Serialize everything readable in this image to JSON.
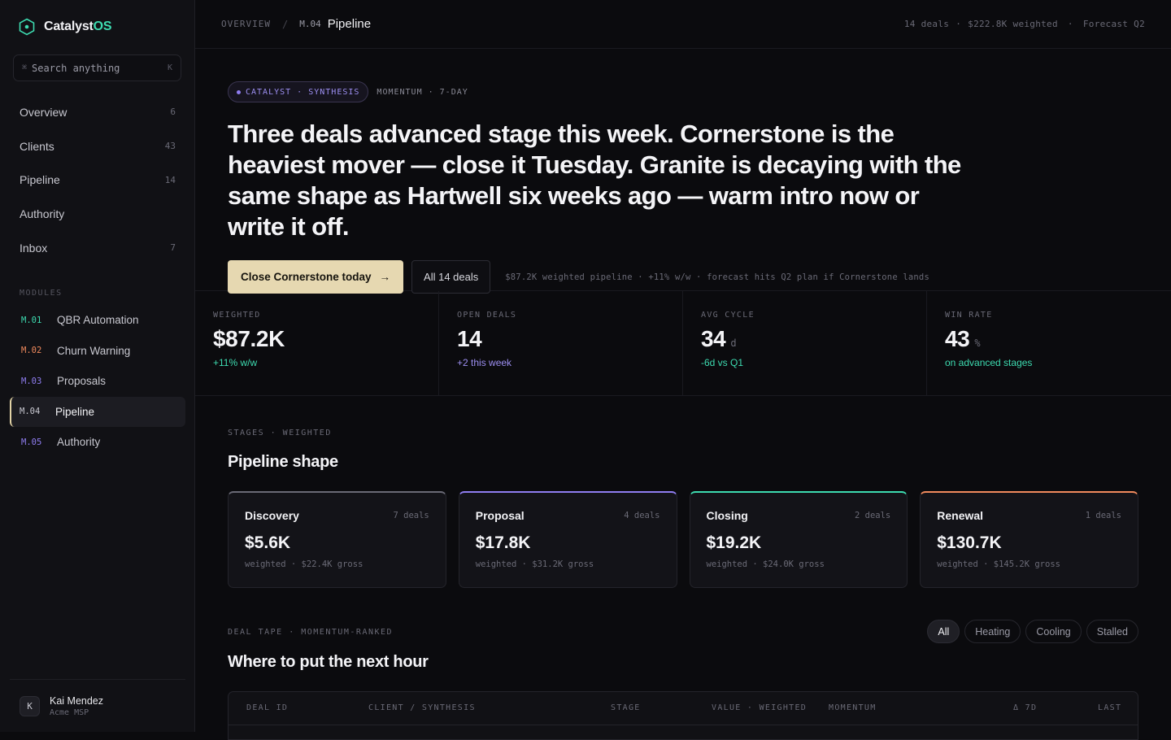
{
  "brand": {
    "name_main": "Catalyst",
    "name_accent": "OS"
  },
  "search": {
    "placeholder": "Search anything",
    "icon": "command-icon",
    "shortcut": "K"
  },
  "nav": [
    {
      "label": "Overview",
      "count": "6"
    },
    {
      "label": "Clients",
      "count": "43"
    },
    {
      "label": "Pipeline",
      "count": "14"
    },
    {
      "label": "Authority",
      "count": ""
    },
    {
      "label": "Inbox",
      "count": "7"
    }
  ],
  "modules": {
    "title": "MODULES",
    "items": [
      {
        "code": "M.01",
        "label": "QBR Automation",
        "color": "#3ddbb0",
        "active": false
      },
      {
        "code": "M.02",
        "label": "Churn Warning",
        "color": "#f08a5d",
        "active": false
      },
      {
        "code": "M.03",
        "label": "Proposals",
        "color": "#8f7df0",
        "active": false
      },
      {
        "code": "M.04",
        "label": "Pipeline",
        "color": "#c8c8d0",
        "active": true
      },
      {
        "code": "M.05",
        "label": "Authority",
        "color": "#8f7df0",
        "active": false
      }
    ]
  },
  "user": {
    "initial": "K",
    "name": "Kai Mendez",
    "org": "Acme MSP"
  },
  "topbar": {
    "crumb_root": "OVERVIEW",
    "crumb_sep": "/",
    "crumb_code": "M.04",
    "crumb_title": "Pipeline",
    "meta_1": "14 deals",
    "meta_sep": "·",
    "meta_2": "$222.8K weighted",
    "meta_3": "Forecast Q2"
  },
  "hero": {
    "pill": "CATALYST · SYNTHESIS",
    "pill_after": "MOMENTUM · 7-DAY",
    "headline": "Three deals advanced stage this week. Cornerstone is the heaviest mover — close it Tuesday. Granite is decaying with the same shape as Hartwell six weeks ago — warm intro now or write it off.",
    "primary_cta": "Close Cornerstone today",
    "secondary_cta": "All 14 deals",
    "meta": "$87.2K weighted pipeline · +11% w/w · forecast hits Q2 plan if Cornerstone lands"
  },
  "kpis": [
    {
      "label": "WEIGHTED",
      "value": "$87.2K",
      "unit": "",
      "sub": "+11% w/w",
      "color": "#3ddbb0"
    },
    {
      "label": "OPEN DEALS",
      "value": "14",
      "unit": "",
      "sub": "+2 this week",
      "color": "#9d8ff2"
    },
    {
      "label": "AVG CYCLE",
      "value": "34",
      "unit": "d",
      "sub": "-6d vs Q1",
      "color": "#3ddbb0"
    },
    {
      "label": "WIN RATE",
      "value": "43",
      "unit": "%",
      "sub": "on advanced stages",
      "color": "#3ddbb0"
    }
  ],
  "stages_section": {
    "label": "STAGES · WEIGHTED",
    "title": "Pipeline shape"
  },
  "stages": [
    {
      "name": "Discovery",
      "count": "7 deals",
      "value": "$5.6K",
      "sub": "weighted · $22.4K gross",
      "color": "#6a6a76"
    },
    {
      "name": "Proposal",
      "count": "4 deals",
      "value": "$17.8K",
      "sub": "weighted · $31.2K gross",
      "color": "#8f7df0"
    },
    {
      "name": "Closing",
      "count": "2 deals",
      "value": "$19.2K",
      "sub": "weighted · $24.0K gross",
      "color": "#3ddbb0"
    },
    {
      "name": "Renewal",
      "count": "1 deals",
      "value": "$130.7K",
      "sub": "weighted · $145.2K gross",
      "color": "#f08a5d"
    }
  ],
  "tape_section": {
    "label": "DEAL TAPE · MOMENTUM-RANKED",
    "title": "Where to put the next hour"
  },
  "filters": [
    "All",
    "Heating",
    "Cooling",
    "Stalled"
  ],
  "table": {
    "headers": [
      "DEAL ID",
      "CLIENT / SYNTHESIS",
      "STAGE",
      "VALUE · WEIGHTED",
      "MOMENTUM",
      "Δ 7D",
      "LAST"
    ]
  }
}
